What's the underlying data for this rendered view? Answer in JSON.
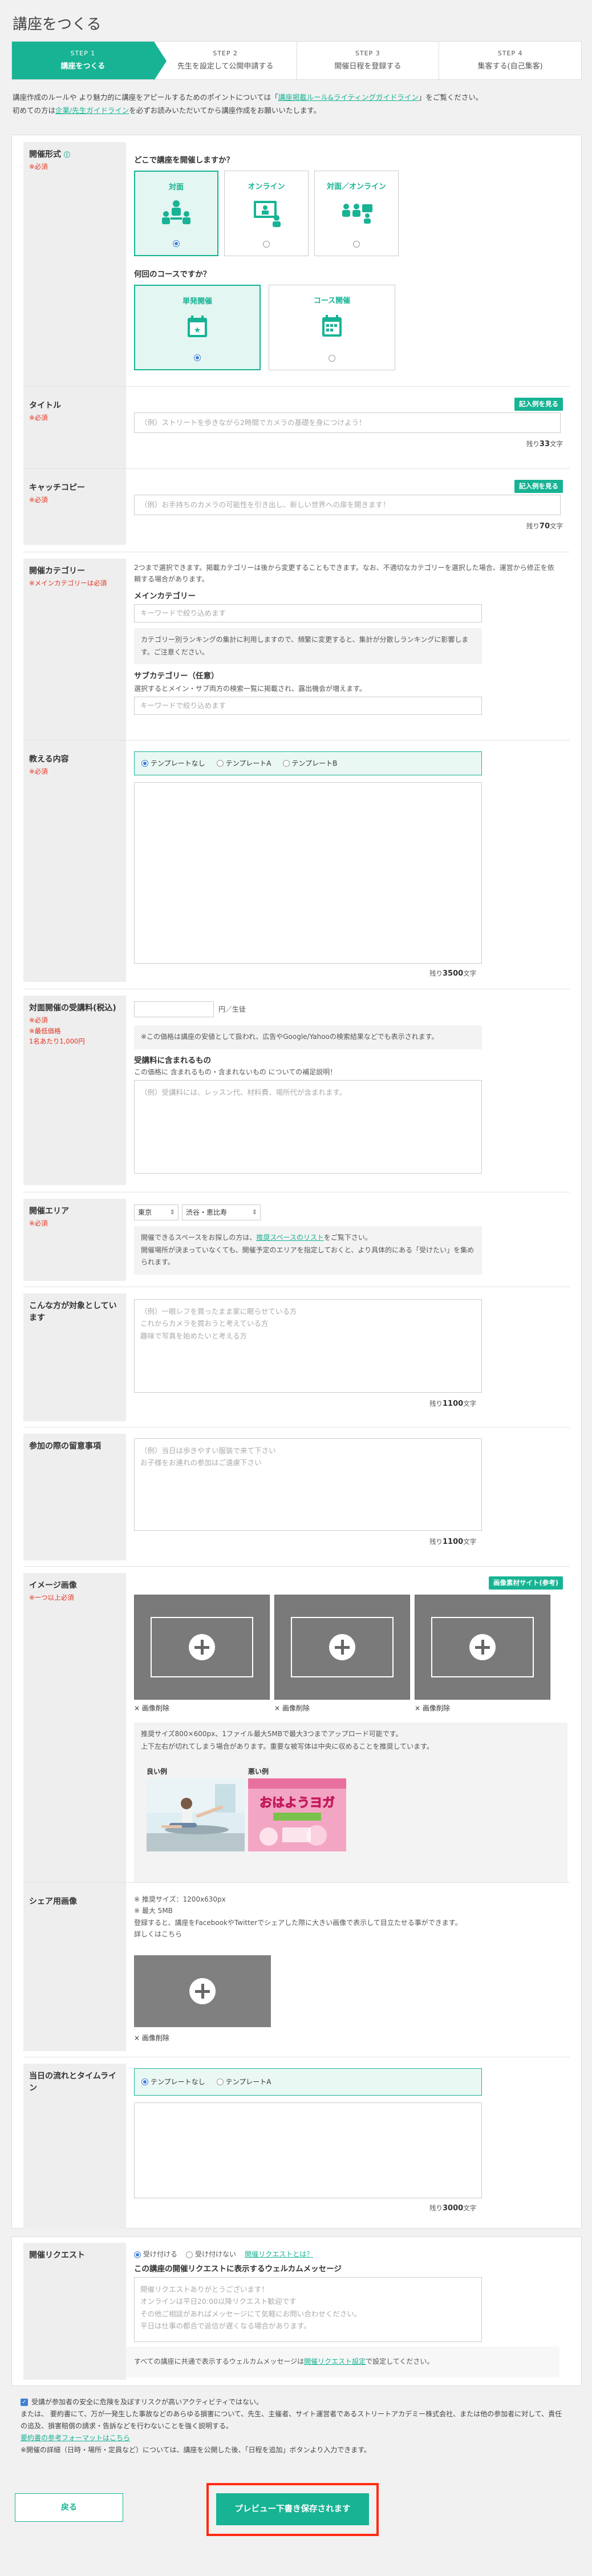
{
  "page": {
    "title": "講座をつくる"
  },
  "steps": [
    {
      "no": "STEP 1",
      "label": "講座をつくる"
    },
    {
      "no": "STEP 2",
      "label": "先生を設定して公開申請する"
    },
    {
      "no": "STEP 3",
      "label": "開催日程を登録する"
    },
    {
      "no": "STEP 4",
      "label": "集客する(自己集客)"
    }
  ],
  "intro": {
    "line1_pre": "講座作成のルールや より魅力的に講座をアピールするためのポイントについては「",
    "line1_link": "講座掲載ルール&ライティングガイドライン",
    "line1_post": "」をご覧ください。",
    "line2_pre": "初めての方は",
    "line2_link": "企業/先生ガイドライン",
    "line2_post": "を必ずお読みいただいてから講座作成をお願いいたします。"
  },
  "required": "※必須",
  "format": {
    "label": "開催形式",
    "question": "どこで講座を開催しますか？",
    "options": [
      "対面",
      "オンライン",
      "対面／オンライン"
    ],
    "course_question": "何回のコースですか？",
    "course_options": [
      "単発開催",
      "コース開催"
    ]
  },
  "title_field": {
    "label": "タイトル",
    "example_btn": "記入例を見る",
    "placeholder": "（例）ストリートを歩きながら2時間でカメラの基礎を身につけよう！",
    "counter_pre": "残り",
    "counter_num": "33",
    "counter_post": "文字"
  },
  "catch": {
    "label": "キャッチコピー",
    "example_btn": "記入例を見る",
    "placeholder": "（例）お手持ちのカメラの可能性を引き出し、新しい世界への扉を開きます！",
    "counter_pre": "残り",
    "counter_num": "70",
    "counter_post": "文字"
  },
  "category": {
    "label": "開催カテゴリー",
    "req": "※メインカテゴリーは必須",
    "desc": "2つまで選択できます。掲載カテゴリーは後から変更することもできます。なお、不適切なカテゴリーを選択した場合、運営から修正を依頼する場合があります。",
    "main_label": "メインカテゴリー",
    "main_placeholder": "キーワードで絞り込めます",
    "main_note": "カテゴリー別ランキングの集計に利用しますので、頻繁に変更すると、集計が分散しランキングに影響します。ご注意ください。",
    "sub_label": "サブカテゴリー（任意）",
    "sub_desc": "選択するとメイン・サブ両方の検索一覧に掲載され、露出機会が増えます。",
    "sub_placeholder": "キーワードで絞り込めます"
  },
  "content": {
    "label": "教える内容",
    "templates": [
      "テンプレートなし",
      "テンプレートA",
      "テンプレートB"
    ],
    "counter_pre": "残り",
    "counter_num": "3500",
    "counter_post": "文字"
  },
  "fee": {
    "label": "対面開催の受講料(税込)",
    "req": "※必須",
    "req2": "※最低価格",
    "req3": "1名あたり1,000円",
    "unit": "円／生徒",
    "note": "※この価格は講座の安値として扱われ、広告やGoogle/Yahooの検索結果などでも表示されます。",
    "inc_label": "受講料に含まれるもの",
    "inc_desc": "この価格に 含まれるもの・含まれないもの についての補足説明！",
    "inc_placeholder": "（例）受講料には、レッスン代、材料費、場所代が含まれます。"
  },
  "area": {
    "label": "開催エリア",
    "pref": "東京",
    "city": "渋谷・恵比寿",
    "note_pre": "開催できるスペースをお探しの方は、",
    "note_link": "推奨スペースのリスト",
    "note_post": "をご覧下さい。",
    "note2": "開催場所が決まっていなくても、開催予定のエリアを指定しておくと、より具体的にある「受けたい」を集められます。"
  },
  "target": {
    "label": "こんな方が対象としています",
    "placeholder": "（例）一眼レフを買ったまま家に眠らせている方\nこれからカメラを買おうと考えている方\n趣味で写真を始めたいと考える方",
    "counter_pre": "残り",
    "counter_num": "1100",
    "counter_post": "文字"
  },
  "notice": {
    "label": "参加の際の留意事項",
    "placeholder": "（例）当日は歩きやすい服装で来て下さい\nお子様をお連れの参加はご遠慮下さい",
    "counter_pre": "残り",
    "counter_num": "1100",
    "counter_post": "文字"
  },
  "images": {
    "label": "イメージ画像",
    "req": "※一つ以上必須",
    "sample_btn": "画像素材サイト(参考)",
    "delete": "× 画像削除",
    "tips1": "推奨サイズ800×600px、1ファイル最大5MBで最大3つまでアップロード可能です。",
    "tips2": "上下左右が切れてしまう場合があります。重要な被写体は中央に収めることを推奨しています。",
    "good": "良い例",
    "bad": "悪い例",
    "bad_banner": "おはようヨガ"
  },
  "share": {
    "label": "シェア用画像",
    "spec1": "※ 推奨サイズ：1200x630px",
    "spec2": "※ 最大 5MB",
    "desc": "登録すると、講座をFacebookやTwitterでシェアした際に大きい画像で表示して目立たせる事ができます。",
    "more": "詳しくはこちら",
    "delete": "× 画像削除"
  },
  "flow": {
    "label": "当日の流れとタイムライン",
    "templates": [
      "テンプレートなし",
      "テンプレートA"
    ],
    "counter_pre": "残り",
    "counter_num": "3000",
    "counter_post": "文字"
  },
  "request": {
    "label": "開催リクエスト",
    "accept": "受け付ける",
    "reject": "受け付けない",
    "what": "開催リクエストとは？",
    "welcome_label": "この講座の開催リクエストに表示するウェルカムメッセージ",
    "welcome_placeholder": "開催リクエストありがとうございます！\nオンラインは平日20:00以降リクエスト歓迎です\nその他ご相談があればメッセージにて気軽にお問い合わせください。\n平日は仕事の都合で返信が遅くなる場合があります。",
    "foot_pre": "すべての講座に共通で表示するウェルカムメッセージは",
    "foot_link": "開催リクエスト設定",
    "foot_post": "で設定してください。"
  },
  "agree": {
    "line1": "受講が参加者の安全に危険を及ぼすリスクが高いアクティビティではない。",
    "line2": "または、 要約書にて、万が一発生した事故などのあらゆる損害について、先生、主催者、サイト運営者であるストリートアカデミー株式会社、または他の参加者に対して、責任の追及、損害賠償の請求・告訴などを行わないことを強く説明する。",
    "line3": "要約書の参考フォーマットはこちら",
    "line4": "※開催の詳細（日時・場所・定員など）については、講座を公開した後、「日程を追加」ボタンより入力できます。"
  },
  "actions": {
    "back": "戻る",
    "preview": "プレビュー下書き保存されます"
  }
}
